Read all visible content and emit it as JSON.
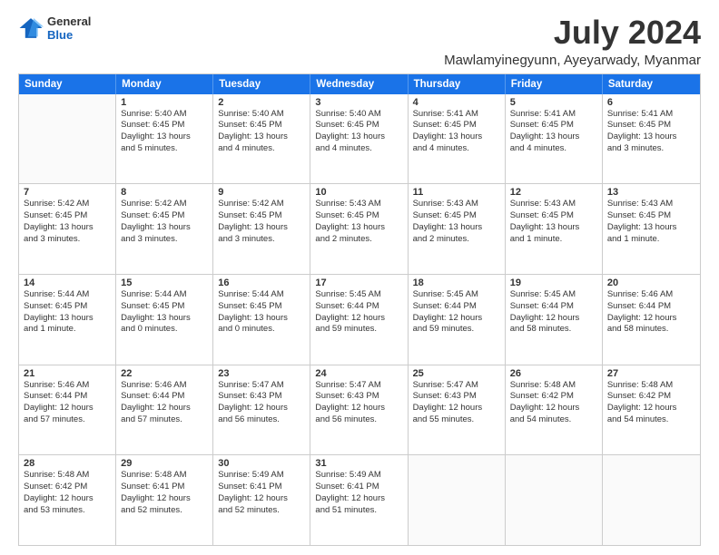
{
  "logo": {
    "general": "General",
    "blue": "Blue"
  },
  "header": {
    "month": "July 2024",
    "location": "Mawlamyinegyunn, Ayeyarwady, Myanmar"
  },
  "days": [
    "Sunday",
    "Monday",
    "Tuesday",
    "Wednesday",
    "Thursday",
    "Friday",
    "Saturday"
  ],
  "weeks": [
    [
      {
        "day": "",
        "lines": []
      },
      {
        "day": "1",
        "lines": [
          "Sunrise: 5:40 AM",
          "Sunset: 6:45 PM",
          "Daylight: 13 hours",
          "and 5 minutes."
        ]
      },
      {
        "day": "2",
        "lines": [
          "Sunrise: 5:40 AM",
          "Sunset: 6:45 PM",
          "Daylight: 13 hours",
          "and 4 minutes."
        ]
      },
      {
        "day": "3",
        "lines": [
          "Sunrise: 5:40 AM",
          "Sunset: 6:45 PM",
          "Daylight: 13 hours",
          "and 4 minutes."
        ]
      },
      {
        "day": "4",
        "lines": [
          "Sunrise: 5:41 AM",
          "Sunset: 6:45 PM",
          "Daylight: 13 hours",
          "and 4 minutes."
        ]
      },
      {
        "day": "5",
        "lines": [
          "Sunrise: 5:41 AM",
          "Sunset: 6:45 PM",
          "Daylight: 13 hours",
          "and 4 minutes."
        ]
      },
      {
        "day": "6",
        "lines": [
          "Sunrise: 5:41 AM",
          "Sunset: 6:45 PM",
          "Daylight: 13 hours",
          "and 3 minutes."
        ]
      }
    ],
    [
      {
        "day": "7",
        "lines": [
          "Sunrise: 5:42 AM",
          "Sunset: 6:45 PM",
          "Daylight: 13 hours",
          "and 3 minutes."
        ]
      },
      {
        "day": "8",
        "lines": [
          "Sunrise: 5:42 AM",
          "Sunset: 6:45 PM",
          "Daylight: 13 hours",
          "and 3 minutes."
        ]
      },
      {
        "day": "9",
        "lines": [
          "Sunrise: 5:42 AM",
          "Sunset: 6:45 PM",
          "Daylight: 13 hours",
          "and 3 minutes."
        ]
      },
      {
        "day": "10",
        "lines": [
          "Sunrise: 5:43 AM",
          "Sunset: 6:45 PM",
          "Daylight: 13 hours",
          "and 2 minutes."
        ]
      },
      {
        "day": "11",
        "lines": [
          "Sunrise: 5:43 AM",
          "Sunset: 6:45 PM",
          "Daylight: 13 hours",
          "and 2 minutes."
        ]
      },
      {
        "day": "12",
        "lines": [
          "Sunrise: 5:43 AM",
          "Sunset: 6:45 PM",
          "Daylight: 13 hours",
          "and 1 minute."
        ]
      },
      {
        "day": "13",
        "lines": [
          "Sunrise: 5:43 AM",
          "Sunset: 6:45 PM",
          "Daylight: 13 hours",
          "and 1 minute."
        ]
      }
    ],
    [
      {
        "day": "14",
        "lines": [
          "Sunrise: 5:44 AM",
          "Sunset: 6:45 PM",
          "Daylight: 13 hours",
          "and 1 minute."
        ]
      },
      {
        "day": "15",
        "lines": [
          "Sunrise: 5:44 AM",
          "Sunset: 6:45 PM",
          "Daylight: 13 hours",
          "and 0 minutes."
        ]
      },
      {
        "day": "16",
        "lines": [
          "Sunrise: 5:44 AM",
          "Sunset: 6:45 PM",
          "Daylight: 13 hours",
          "and 0 minutes."
        ]
      },
      {
        "day": "17",
        "lines": [
          "Sunrise: 5:45 AM",
          "Sunset: 6:44 PM",
          "Daylight: 12 hours",
          "and 59 minutes."
        ]
      },
      {
        "day": "18",
        "lines": [
          "Sunrise: 5:45 AM",
          "Sunset: 6:44 PM",
          "Daylight: 12 hours",
          "and 59 minutes."
        ]
      },
      {
        "day": "19",
        "lines": [
          "Sunrise: 5:45 AM",
          "Sunset: 6:44 PM",
          "Daylight: 12 hours",
          "and 58 minutes."
        ]
      },
      {
        "day": "20",
        "lines": [
          "Sunrise: 5:46 AM",
          "Sunset: 6:44 PM",
          "Daylight: 12 hours",
          "and 58 minutes."
        ]
      }
    ],
    [
      {
        "day": "21",
        "lines": [
          "Sunrise: 5:46 AM",
          "Sunset: 6:44 PM",
          "Daylight: 12 hours",
          "and 57 minutes."
        ]
      },
      {
        "day": "22",
        "lines": [
          "Sunrise: 5:46 AM",
          "Sunset: 6:44 PM",
          "Daylight: 12 hours",
          "and 57 minutes."
        ]
      },
      {
        "day": "23",
        "lines": [
          "Sunrise: 5:47 AM",
          "Sunset: 6:43 PM",
          "Daylight: 12 hours",
          "and 56 minutes."
        ]
      },
      {
        "day": "24",
        "lines": [
          "Sunrise: 5:47 AM",
          "Sunset: 6:43 PM",
          "Daylight: 12 hours",
          "and 56 minutes."
        ]
      },
      {
        "day": "25",
        "lines": [
          "Sunrise: 5:47 AM",
          "Sunset: 6:43 PM",
          "Daylight: 12 hours",
          "and 55 minutes."
        ]
      },
      {
        "day": "26",
        "lines": [
          "Sunrise: 5:48 AM",
          "Sunset: 6:42 PM",
          "Daylight: 12 hours",
          "and 54 minutes."
        ]
      },
      {
        "day": "27",
        "lines": [
          "Sunrise: 5:48 AM",
          "Sunset: 6:42 PM",
          "Daylight: 12 hours",
          "and 54 minutes."
        ]
      }
    ],
    [
      {
        "day": "28",
        "lines": [
          "Sunrise: 5:48 AM",
          "Sunset: 6:42 PM",
          "Daylight: 12 hours",
          "and 53 minutes."
        ]
      },
      {
        "day": "29",
        "lines": [
          "Sunrise: 5:48 AM",
          "Sunset: 6:41 PM",
          "Daylight: 12 hours",
          "and 52 minutes."
        ]
      },
      {
        "day": "30",
        "lines": [
          "Sunrise: 5:49 AM",
          "Sunset: 6:41 PM",
          "Daylight: 12 hours",
          "and 52 minutes."
        ]
      },
      {
        "day": "31",
        "lines": [
          "Sunrise: 5:49 AM",
          "Sunset: 6:41 PM",
          "Daylight: 12 hours",
          "and 51 minutes."
        ]
      },
      {
        "day": "",
        "lines": []
      },
      {
        "day": "",
        "lines": []
      },
      {
        "day": "",
        "lines": []
      }
    ]
  ]
}
